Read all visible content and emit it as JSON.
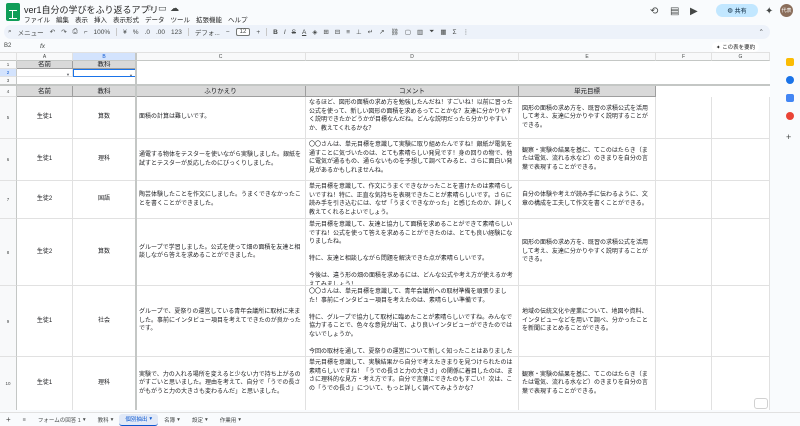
{
  "title": "ver1自分の学びをふり返るアプリ",
  "menu": [
    "ファイル",
    "編集",
    "表示",
    "挿入",
    "表示形式",
    "データ",
    "ツール",
    "拡張機能",
    "ヘルプ"
  ],
  "share_label": "共有",
  "avatar_text": "代表",
  "toolbar": {
    "menu_label": "メニュー",
    "zoom": "100%",
    "font": "デフォ...",
    "font_size": "12"
  },
  "name_box": "B2",
  "fx": "fx",
  "summarize": "この表を要約",
  "columns": [
    "A",
    "B",
    "C",
    "D",
    "E",
    "F",
    "G"
  ],
  "top_headers": [
    "名前",
    "教科"
  ],
  "headers": [
    "名前",
    "教科",
    "ふりかえり",
    "コメント",
    "単元目標"
  ],
  "rows": [
    {
      "num": "5",
      "name": "生徒1",
      "subject": "算数",
      "reflection": "面積の計算は難しいです。",
      "comment": "なるほど、図形の面積の求め方を勉強したんだね！すごいね！以前に習った公式を使って、新しい図形の面積を求めるってことかな？友達に分かりやすく説明できたかどうかが目標なんだね。どんな説明だったら分かりやすいか、教えてくれるかな？",
      "goal": "図形の面積の求め方を、既習の求積公式を活用して考え、友達に分かりやすく説明することができる。"
    },
    {
      "num": "6",
      "name": "生徒1",
      "subject": "理科",
      "reflection": "通電する物体をテスターを使いながら実験しました。銀紙を試すとテスターが反応したのにびっくりしました。",
      "comment": "〇〇さんは、単元目標を意識して実験に取り組めたんですね！銀紙が電気を通すことに気づいたのは、とても素晴らしい発見です！身の回りの物で、他に電気が通るもの、通らないものを予想して調べてみると、さらに面白い発見があるかもしれませんね。",
      "goal": "観察・実験の結果を基に、てこのはたらき（または電気、流れる水など）のきまりを自分の言葉で表現することができる。"
    },
    {
      "num": "7",
      "name": "生徒2",
      "subject": "国語",
      "reflection": "陶芸体験したことを作文にしました。うまくできなかったことを書くことができました。",
      "comment": "単元目標を意識して、作文にうまくできなかったことを書けたのは素晴らしいですね！特に、正直な気持ちを表現できたことが素晴らしいです。さらに読み手を引き込むには、なぜ「うまくできなかった」と感じたのか、詳しく教えてくれるとよいでしょう。",
      "goal": "自分の体験や考えが読み手に伝わるように、文章の構成を工夫して作文を書くことができる。"
    },
    {
      "num": "8",
      "name": "生徒2",
      "subject": "算数",
      "reflection": "グループで学習しました。公式を使って畑の面積を友達と相談しながら答えを求めることができました。",
      "comment": "単元目標を意識して、友達と協力して面積を求めることができて素晴らしいですね！公式を使って答えを求めることができたのは、とても良い経験になりましたね。\n\n特に、友達と相談しながら問題を解決できた点が素晴らしいです。\n\n今後は、違う形の畑の面積を求めるには、どんな公式や考え方が使えるか考えてみましょう！",
      "goal": "図形の面積の求め方を、既習の求積公式を活用して考え、友達に分かりやすく説明することができる。"
    },
    {
      "num": "9",
      "name": "生徒1",
      "subject": "社会",
      "reflection": "グループで、夏祭りの運営している青年会議所に取材に来ました。事前にインタビュー項目を考えてできたのが良かったです。",
      "comment": "〇〇さんは、単元目標を意識して、青年会議所への取材準備を頑張りました！事前にインタビュー項目を考えたのは、素晴らしい準備です。\n\n特に、グループで協力して取材に臨めたことが素晴らしいですね。みんなで協力することで、色々な意見が出て、より良いインタビューができたのではないでしょうか。\n\n今回の取材を通して、夏祭りの運営について新しく知ったことはありましたか？",
      "goal": "地域の伝統文化や産業について、地図や資料、インタビューなどを用いて調べ、分かったことを新聞にまとめることができる。"
    },
    {
      "num": "10",
      "name": "生徒1",
      "subject": "理科",
      "reflection": "実験で、力の入れる場所を変えると少ない力で持ち上がるのがすごいと思いました。理由を考えて、自分で「うでの長さがもがうと力の大きさも変わるんだ」と思いました。",
      "comment": "単元目標を意識して、実験結果から自分で考えたきまりを見つけられたのは素晴らしいですね！「うでの長さと力の大きさ」の関係に着目したのは、まさに理科的な見方・考え方です。自分で言葉にできたのもすごい！次は、この「うでの長さ」について、もっと詳しく調べてみようかな？",
      "goal": "観察・実験の結果を基に、てこのはたらき（または電気、流れる水など）のきまりを自分の言葉で表現することができる。"
    }
  ],
  "tabs": [
    "フォームの回答 1",
    "教科",
    "個別抽出",
    "名簿",
    "設定",
    "作業用"
  ],
  "active_tab": "個別抽出",
  "colors": {
    "accent": "#0b57d0",
    "header_gray": "#d9d9d9",
    "share_bg": "#c2e7ff"
  }
}
